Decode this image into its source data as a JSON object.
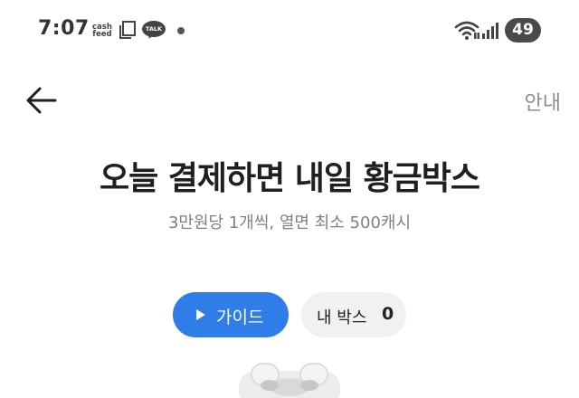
{
  "status_bar": {
    "time": "7:07",
    "cashfeed_line1": "cash",
    "cashfeed_line2": "feed",
    "talk_label": "TALK",
    "battery": "49"
  },
  "nav": {
    "back_icon": "arrow-left-icon",
    "guide_link": "안내"
  },
  "hero": {
    "title": "오늘 결제하면 내일 황금박스",
    "subtitle": "3만원당 1개씩, 열면 최소 500캐시"
  },
  "actions": {
    "guide_button": "가이드",
    "my_box_label": "내 박스",
    "my_box_count": "0"
  },
  "colors": {
    "accent": "#2f7de8",
    "chip_bg": "#f1f1f1"
  }
}
